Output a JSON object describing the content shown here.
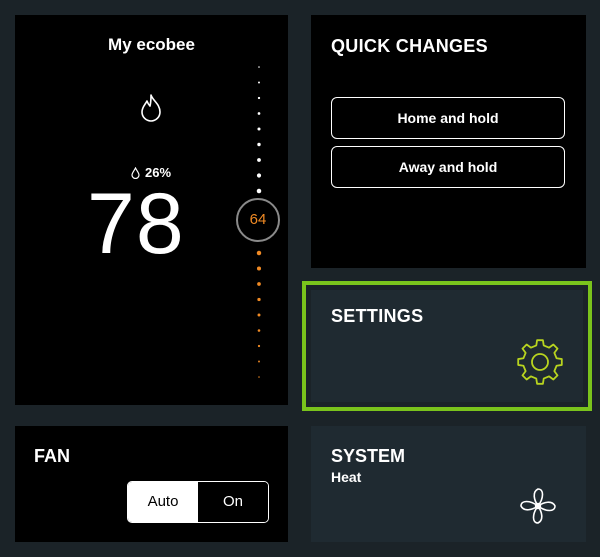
{
  "thermostat": {
    "title": "My ecobee",
    "humidity": "26%",
    "current_temp": "78",
    "setpoint": "64",
    "mode_icon": "flame-icon",
    "colors": {
      "setpoint": "#f08a24",
      "scale_active": "#f08a24",
      "scale_inactive": "#ffffff"
    }
  },
  "quick_changes": {
    "title": "QUICK CHANGES",
    "buttons": [
      "Home and hold",
      "Away and hold"
    ]
  },
  "settings": {
    "title": "SETTINGS",
    "icon": "gear-icon",
    "focus_color": "#7ac31c"
  },
  "fan": {
    "title": "FAN",
    "options": [
      "Auto",
      "On"
    ],
    "selected": "Auto"
  },
  "system": {
    "title": "SYSTEM",
    "mode": "Heat",
    "icon": "fan-icon"
  }
}
